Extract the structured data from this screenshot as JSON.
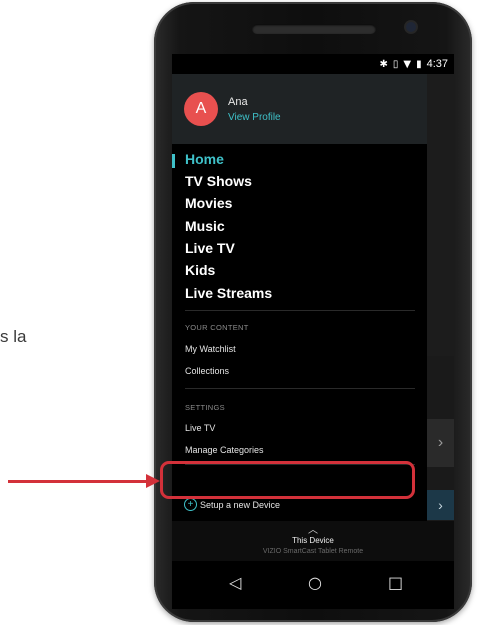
{
  "outside_text": "s la",
  "status": {
    "time": "4:37",
    "icons": [
      "bluetooth-icon",
      "vibrate-icon",
      "wifi-icon",
      "battery-icon"
    ]
  },
  "profile": {
    "initial": "A",
    "name": "Ana",
    "link": "View Profile"
  },
  "nav": {
    "items": [
      "Home",
      "TV Shows",
      "Movies",
      "Music",
      "Live TV",
      "Kids",
      "Live Streams"
    ],
    "active": "Home"
  },
  "your_content": {
    "label": "YOUR CONTENT",
    "items": [
      "My Watchlist",
      "Collections"
    ]
  },
  "settings": {
    "label": "SETTINGS",
    "items": [
      "Live TV",
      "Manage Categories"
    ]
  },
  "setup": {
    "label": "Setup a new Device"
  },
  "remote": {
    "title": "This Device",
    "subtitle": "VIZIO SmartCast Tablet Remote"
  },
  "colors": {
    "accent": "#3fc1c9",
    "avatar": "#e8504f",
    "highlight": "#d3313a"
  }
}
